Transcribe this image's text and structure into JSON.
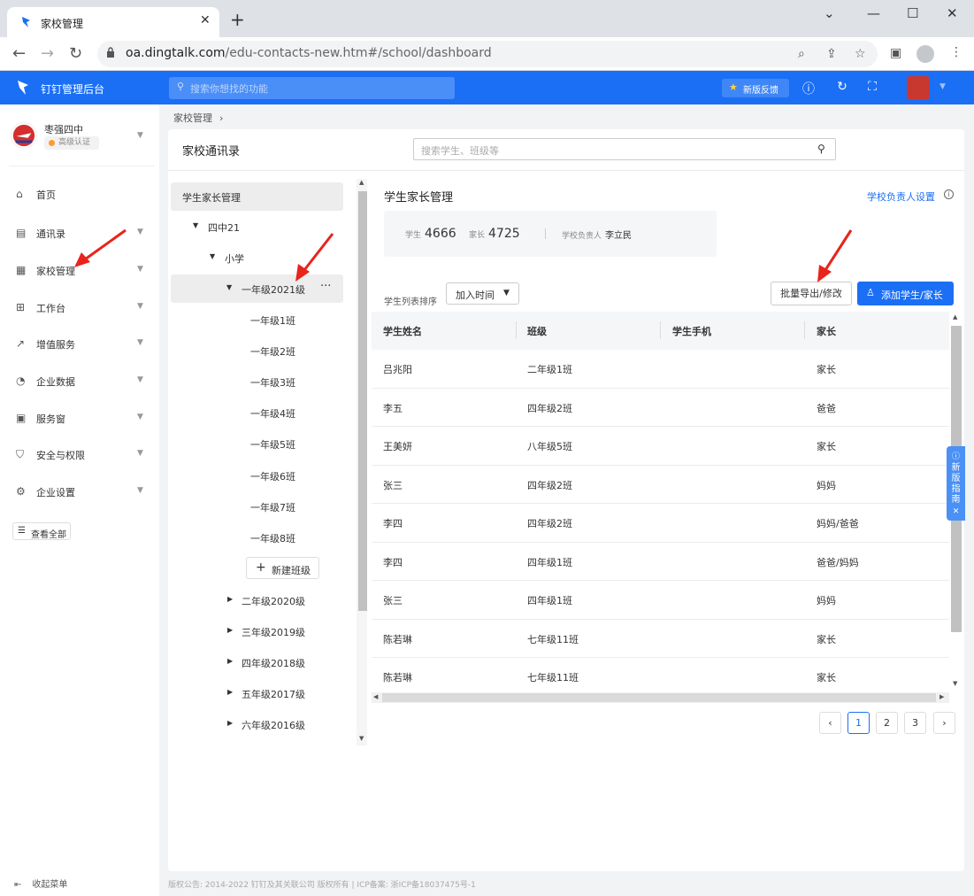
{
  "browser": {
    "tab_title": "家校管理",
    "url_host": "oa.dingtalk.com",
    "url_path": "/edu-contacts-new.htm#/school/dashboard"
  },
  "header": {
    "app_title": "钉钉管理后台",
    "search_placeholder": "搜索你想找的功能",
    "feedback_label": "新版反馈"
  },
  "org": {
    "name": "枣强四中",
    "badge": "高级认证"
  },
  "sidebar": {
    "items": [
      {
        "label": "首页",
        "icon": "home-icon"
      },
      {
        "label": "通讯录",
        "icon": "contacts-icon"
      },
      {
        "label": "家校管理",
        "icon": "school-icon"
      },
      {
        "label": "工作台",
        "icon": "grid-icon"
      },
      {
        "label": "增值服务",
        "icon": "trend-icon"
      },
      {
        "label": "企业数据",
        "icon": "chart-icon"
      },
      {
        "label": "服务窗",
        "icon": "window-icon"
      },
      {
        "label": "安全与权限",
        "icon": "shield-icon"
      },
      {
        "label": "企业设置",
        "icon": "settings-icon"
      }
    ],
    "view_all": "查看全部",
    "collapse": "收起菜单"
  },
  "breadcrumb": "家校管理",
  "card": {
    "title": "家校通讯录",
    "search_placeholder": "搜索学生、班级等"
  },
  "tree": {
    "root": "学生家长管理",
    "school": "四中21",
    "section": "小学",
    "grade_open": "一年级2021级",
    "classes": [
      "一年级1班",
      "一年级2班",
      "一年级3班",
      "一年级4班",
      "一年级5班",
      "一年级6班",
      "一年级7班",
      "一年级8班"
    ],
    "new_class": "新建班级",
    "grades": [
      "二年级2020级",
      "三年级2019级",
      "四年级2018级",
      "五年级2017级",
      "六年级2016级"
    ]
  },
  "panel": {
    "title": "学生家长管理",
    "admin_link": "学校负责人设置",
    "stats": {
      "student_label": "学生",
      "student_count": "4666",
      "parent_label": "家长",
      "parent_count": "4725",
      "leader_label": "学校负责人",
      "leader_name": "李立民"
    },
    "sort_label": "学生列表排序",
    "sort_value": "加入时间",
    "export_btn": "批量导出/修改",
    "add_btn": "添加学生/家长"
  },
  "table": {
    "headers": [
      "学生姓名",
      "班级",
      "学生手机",
      "家长"
    ],
    "rows": [
      [
        "吕兆阳",
        "二年级1班",
        "",
        "家长"
      ],
      [
        "李五",
        "四年级2班",
        "",
        "爸爸"
      ],
      [
        "王美妍",
        "八年级5班",
        "",
        "家长"
      ],
      [
        "张三",
        "四年级2班",
        "",
        "妈妈"
      ],
      [
        "李四",
        "四年级2班",
        "",
        "妈妈/爸爸"
      ],
      [
        "李四",
        "四年级1班",
        "",
        "爸爸/妈妈"
      ],
      [
        "张三",
        "四年级1班",
        "",
        "妈妈"
      ],
      [
        "陈若琳",
        "七年级11班",
        "",
        "家长"
      ],
      [
        "陈若琳",
        "七年级11班",
        "",
        "家长"
      ]
    ]
  },
  "pagination": {
    "pages": [
      "1",
      "2",
      "3"
    ],
    "current": "1"
  },
  "guide": {
    "label": "新版指南"
  },
  "footer": "版权公告: 2014-2022 钉钉及其关联公司 版权所有 | ICP备案: 浙ICP备18037475号-1",
  "colors": {
    "brand": "#1b6ff5",
    "annotation": "#e8241c"
  }
}
